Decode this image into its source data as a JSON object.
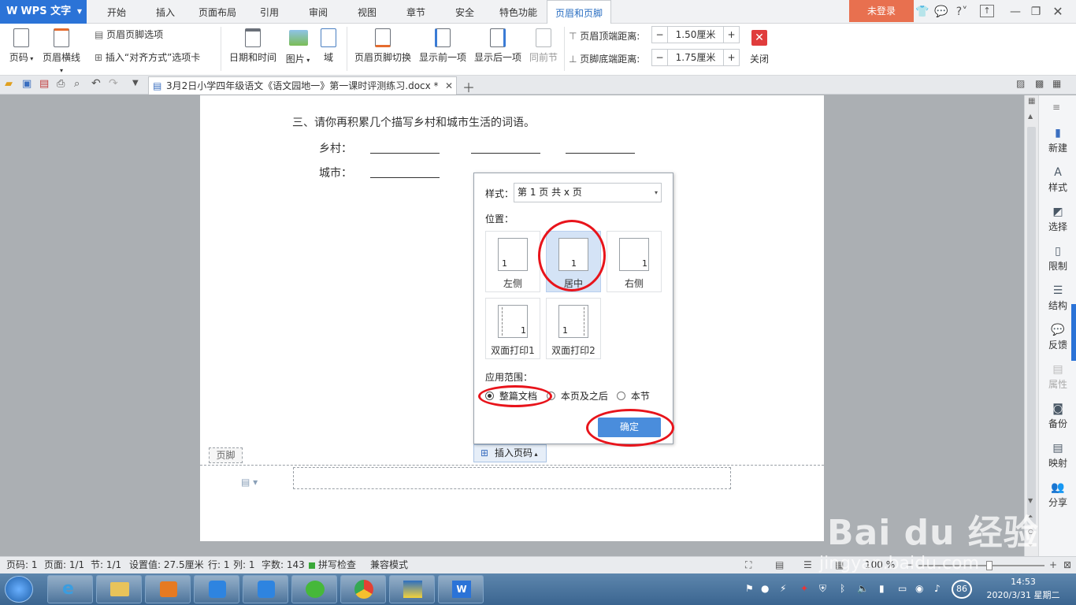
{
  "titlebar": {
    "app_name": "WPS 文字",
    "tabs": [
      "开始",
      "插入",
      "页面布局",
      "引用",
      "审阅",
      "视图",
      "章节",
      "安全",
      "特色功能",
      "页眉和页脚"
    ],
    "active_tab": "页眉和页脚",
    "login": "未登录"
  },
  "ribbon": {
    "page_number": "页码",
    "header_line": "页眉横线",
    "header_footer_options": "页眉页脚选项",
    "insert_align_tab": "插入“对齐方式”选项卡",
    "date_time": "日期和时间",
    "picture": "图片",
    "field": "域",
    "switch": "页眉页脚切换",
    "show_prev": "显示前一项",
    "show_next": "显示后一项",
    "same_as_prev": "同前节",
    "header_top_label": "页眉顶端距离:",
    "header_top_value": "1.50厘米",
    "footer_bottom_label": "页脚底端距离:",
    "footer_bottom_value": "1.75厘米",
    "close": "关闭"
  },
  "doc_tab": {
    "title": "3月2日小学四年级语文《语文园地一》第一课时评测练习.docx *"
  },
  "document": {
    "question": "三、请你再积累几个描写乡村和城市生活的词语。",
    "village": "乡村：",
    "city": "城市：",
    "footer_label": "页脚",
    "insert_page_number": "插入页码"
  },
  "dialog": {
    "style_label": "样式：",
    "style_value": "第 1 页 共 x 页",
    "position_label": "位置：",
    "positions": [
      {
        "label": "左侧",
        "num": "1"
      },
      {
        "label": "居中",
        "num": "1"
      },
      {
        "label": "右侧",
        "num": "1"
      },
      {
        "label": "双面打印1",
        "num": "1"
      },
      {
        "label": "双面打印2",
        "num": "1"
      }
    ],
    "selected_position": "居中",
    "scope_label": "应用范围：",
    "scope_options": [
      "整篇文档",
      "本页及之后",
      "本节"
    ],
    "scope_selected": "整篇文档",
    "ok": "确定"
  },
  "right_panel": [
    "新建",
    "样式",
    "选择",
    "限制",
    "结构",
    "反馈",
    "属性",
    "备份",
    "映射",
    "分享"
  ],
  "status": {
    "page_code": "页码: 1",
    "page": "页面: 1/1",
    "section": "节: 1/1",
    "setting": "设置值: 27.5厘米",
    "row": "行: 1",
    "col": "列: 1",
    "words": "字数: 143",
    "spell": "拼写检查",
    "compat": "兼容模式",
    "zoom": "100 %"
  },
  "taskbar": {
    "time": "14:53",
    "date": "2020/3/31 星期二",
    "badge": "86"
  },
  "watermark": {
    "brand": "Bai du 经验",
    "url": "jingyan.baidu.com"
  },
  "colors": {
    "accent": "#2b73d7",
    "login": "#e8704f",
    "highlight": "#e8141b",
    "ok_button": "#4a8ddc"
  }
}
